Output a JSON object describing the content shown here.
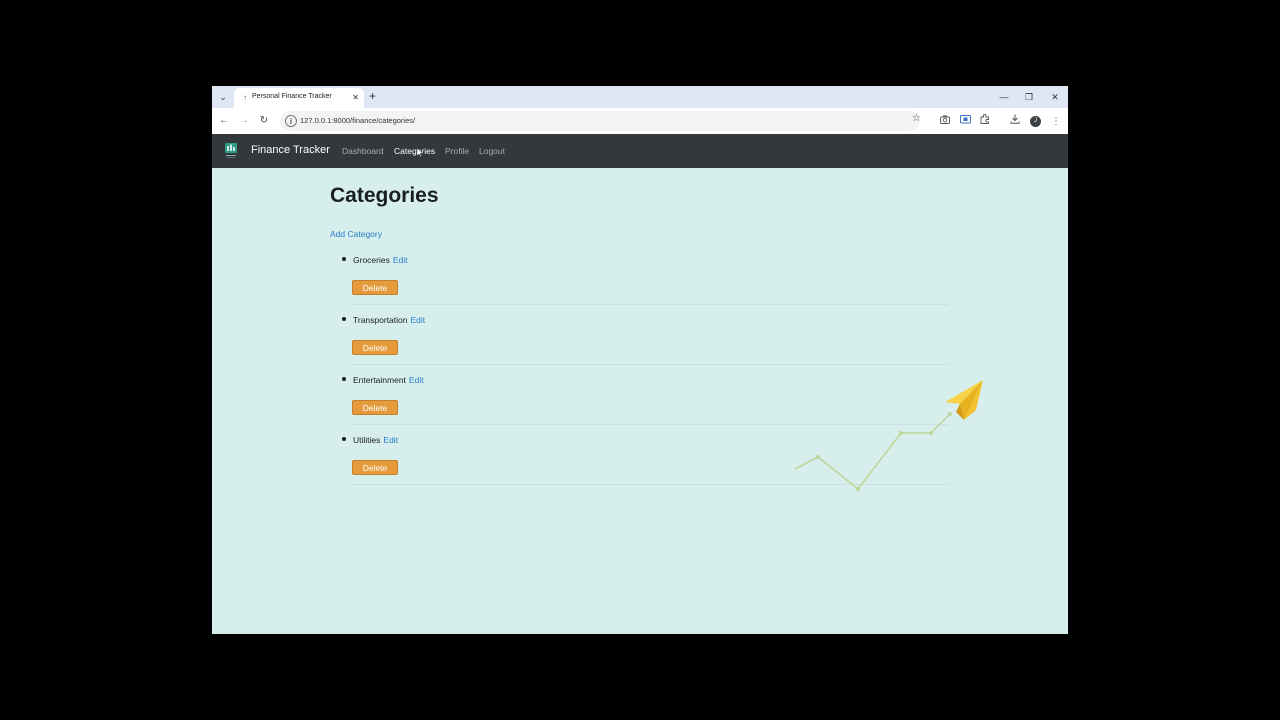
{
  "browser": {
    "tab_title": "Personal Finance Tracker",
    "tab_close": "✕",
    "new_tab": "+",
    "url": "127.0.0.1:8000/finance/categories/",
    "window_controls": {
      "minimize": "—",
      "restore": "❐",
      "close": "✕"
    },
    "profile_initial": "J"
  },
  "navbar": {
    "brand": "Finance Tracker",
    "links": [
      {
        "label": "Dashboard"
      },
      {
        "label": "Categories"
      },
      {
        "label": "Profile"
      },
      {
        "label": "Logout"
      }
    ]
  },
  "main": {
    "title": "Categories",
    "add_link": "Add Category",
    "categories": [
      {
        "name": "Groceries",
        "edit": "Edit",
        "delete": "Delete"
      },
      {
        "name": "Transportation",
        "edit": "Edit",
        "delete": "Delete"
      },
      {
        "name": "Entertainment",
        "edit": "Edit",
        "delete": "Delete"
      },
      {
        "name": "Utilities",
        "edit": "Edit",
        "delete": "Delete"
      }
    ]
  },
  "colors": {
    "background": "#d6eeec",
    "navbar": "#33383c",
    "link": "#2b7bc9",
    "delete_button": "#e59a3b"
  },
  "icons": [
    "chevron-down-icon",
    "page-icon",
    "close-icon",
    "plus-icon",
    "back-arrow-icon",
    "forward-arrow-icon",
    "reload-icon",
    "site-info-icon",
    "star-icon",
    "camera-icon",
    "screen-share-icon",
    "extensions-icon",
    "download-icon",
    "menu-dots-icon",
    "paper-plane-icon"
  ]
}
